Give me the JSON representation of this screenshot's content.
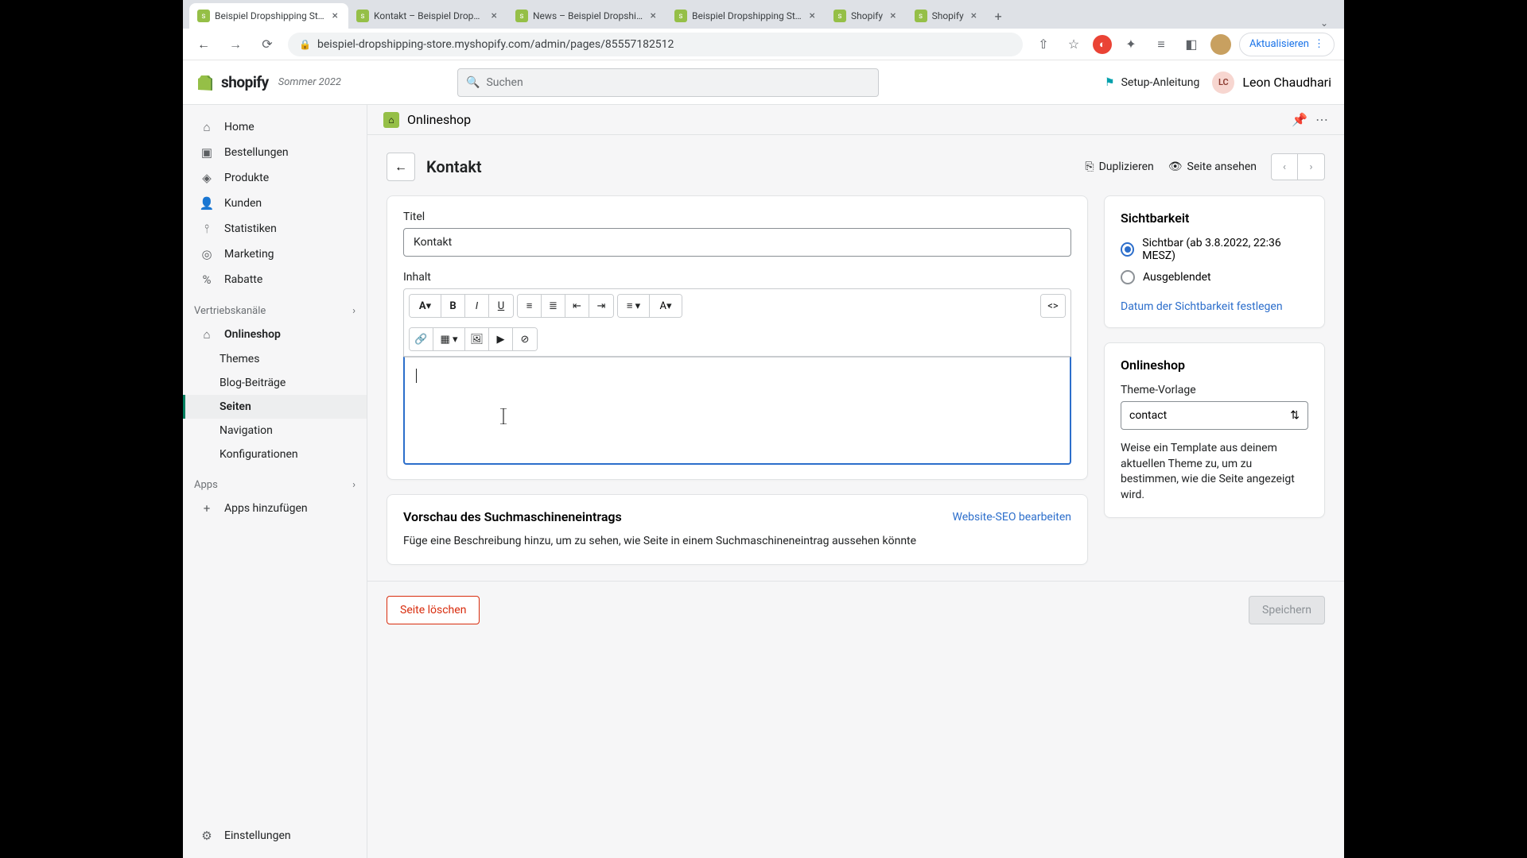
{
  "browser": {
    "tabs": [
      {
        "title": "Beispiel Dropshipping Stor"
      },
      {
        "title": "Kontakt – Beispiel Dropship"
      },
      {
        "title": "News – Beispiel Dropshipp"
      },
      {
        "title": "Beispiel Dropshipping Stor"
      },
      {
        "title": "Shopify"
      },
      {
        "title": "Shopify"
      }
    ],
    "url": "beispiel-dropshipping-store.myshopify.com/admin/pages/85557182512",
    "update_label": "Aktualisieren"
  },
  "topbar": {
    "brand": "shopify",
    "season": "Sommer 2022",
    "search_placeholder": "Suchen",
    "setup_guide": "Setup-Anleitung",
    "user_initials": "LC",
    "user_name": "Leon Chaudhari"
  },
  "sidebar": {
    "items": [
      {
        "label": "Home",
        "icon": "⌂"
      },
      {
        "label": "Bestellungen",
        "icon": "▣"
      },
      {
        "label": "Produkte",
        "icon": "◈"
      },
      {
        "label": "Kunden",
        "icon": "👤"
      },
      {
        "label": "Statistiken",
        "icon": "⫯"
      },
      {
        "label": "Marketing",
        "icon": "◎"
      },
      {
        "label": "Rabatte",
        "icon": "%"
      }
    ],
    "channels_label": "Vertriebskanäle",
    "onlineshop_label": "Onlineshop",
    "sub": [
      {
        "label": "Themes"
      },
      {
        "label": "Blog-Beiträge"
      },
      {
        "label": "Seiten"
      },
      {
        "label": "Navigation"
      },
      {
        "label": "Konfigurationen"
      }
    ],
    "apps_label": "Apps",
    "add_apps": "Apps hinzufügen",
    "settings": "Einstellungen"
  },
  "storebar": {
    "name": "Onlineshop"
  },
  "page": {
    "title": "Kontakt",
    "duplicate": "Duplizieren",
    "view": "Seite ansehen",
    "title_label": "Titel",
    "title_value": "Kontakt",
    "content_label": "Inhalt"
  },
  "seo": {
    "heading": "Vorschau des Suchmaschineneintrags",
    "edit_link": "Website-SEO bearbeiten",
    "description": "Füge eine Beschreibung hinzu, um zu sehen, wie Seite in einem Suchmaschineneintrag aussehen könnte"
  },
  "visibility": {
    "heading": "Sichtbarkeit",
    "visible_label": "Sichtbar (ab 3.8.2022, 22:36 MESZ)",
    "hidden_label": "Ausgeblendet",
    "schedule_link": "Datum der Sichtbarkeit festlegen"
  },
  "theme": {
    "heading": "Onlineshop",
    "template_label": "Theme-Vorlage",
    "template_value": "contact",
    "help": "Weise ein Template aus deinem aktuellen Theme zu, um zu bestimmen, wie die Seite angezeigt wird."
  },
  "footer": {
    "delete": "Seite löschen",
    "save": "Speichern"
  }
}
